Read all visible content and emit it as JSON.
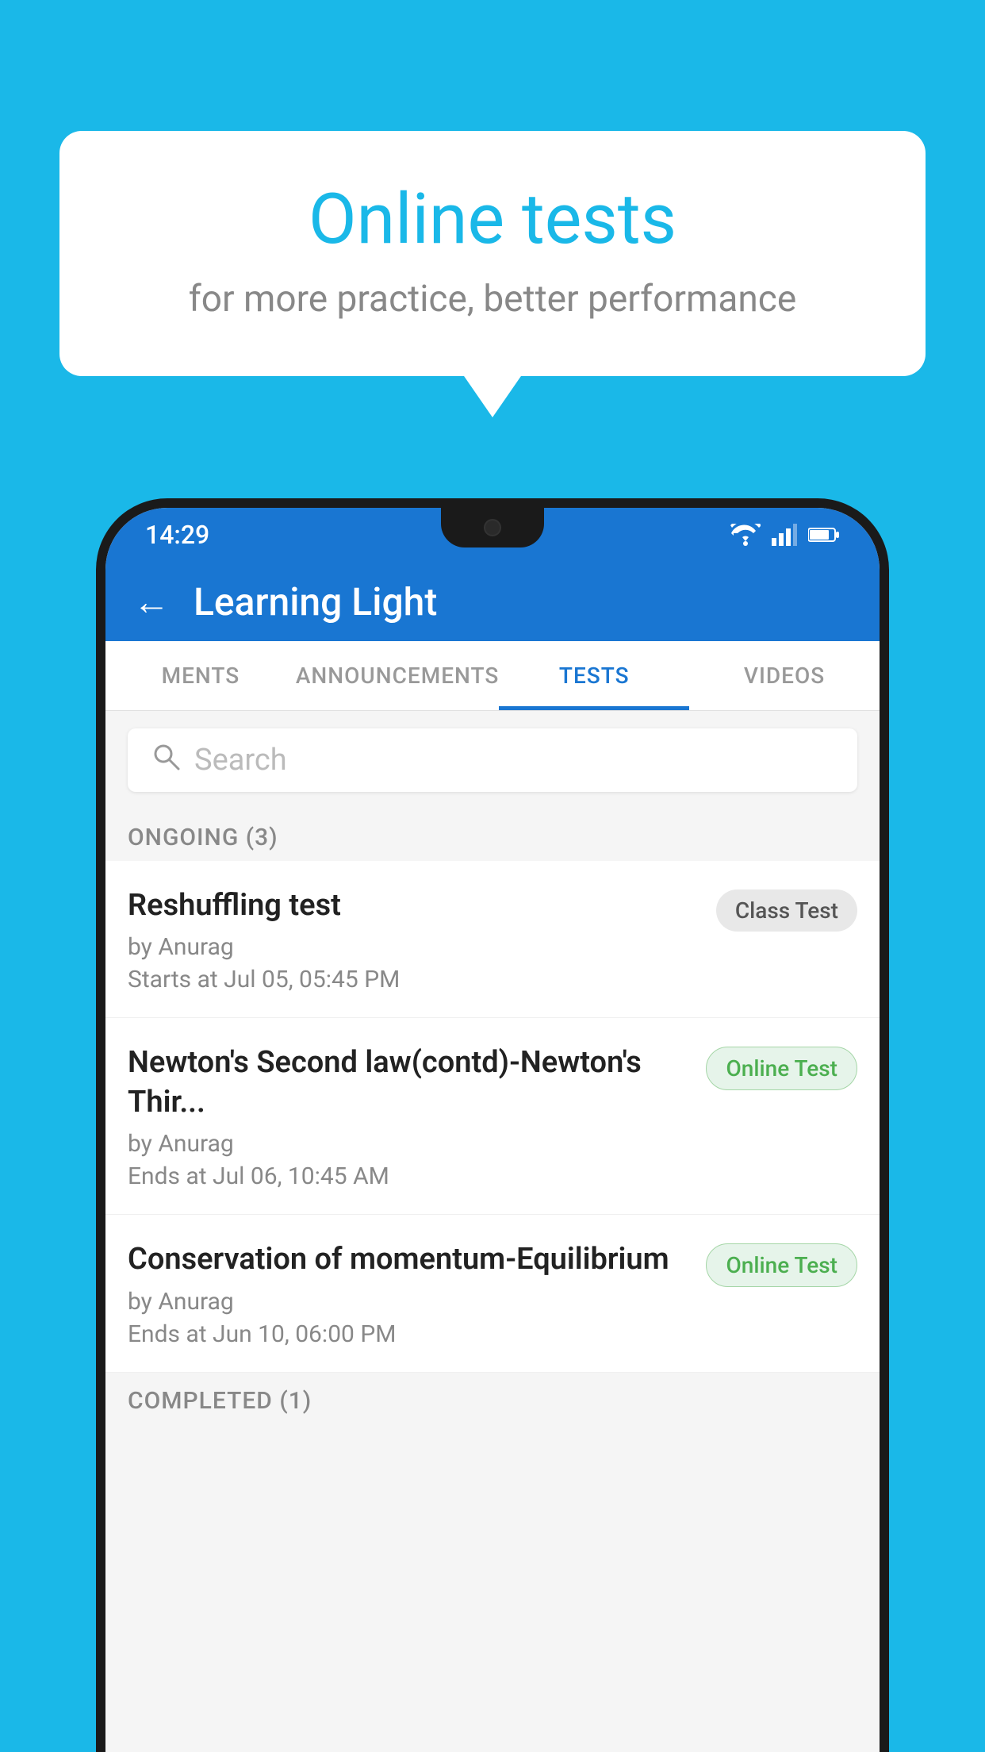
{
  "background": {
    "color": "#1ab8e8"
  },
  "speech_bubble": {
    "title": "Online tests",
    "subtitle": "for more practice, better performance"
  },
  "phone": {
    "status_bar": {
      "time": "14:29",
      "icons": [
        "wifi",
        "signal",
        "battery"
      ]
    },
    "app_bar": {
      "back_label": "←",
      "title": "Learning Light"
    },
    "tabs": [
      {
        "label": "MENTS",
        "active": false
      },
      {
        "label": "ANNOUNCEMENTS",
        "active": false
      },
      {
        "label": "TESTS",
        "active": true
      },
      {
        "label": "VIDEOS",
        "active": false
      }
    ],
    "search": {
      "placeholder": "Search"
    },
    "ongoing_section": {
      "header": "ONGOING (3)",
      "items": [
        {
          "name": "Reshuffling test",
          "by": "by Anurag",
          "time": "Starts at  Jul 05, 05:45 PM",
          "badge": "Class Test",
          "badge_type": "class"
        },
        {
          "name": "Newton's Second law(contd)-Newton's Thir...",
          "by": "by Anurag",
          "time": "Ends at  Jul 06, 10:45 AM",
          "badge": "Online Test",
          "badge_type": "online"
        },
        {
          "name": "Conservation of momentum-Equilibrium",
          "by": "by Anurag",
          "time": "Ends at  Jun 10, 06:00 PM",
          "badge": "Online Test",
          "badge_type": "online"
        }
      ]
    },
    "completed_section": {
      "header": "COMPLETED (1)"
    }
  }
}
